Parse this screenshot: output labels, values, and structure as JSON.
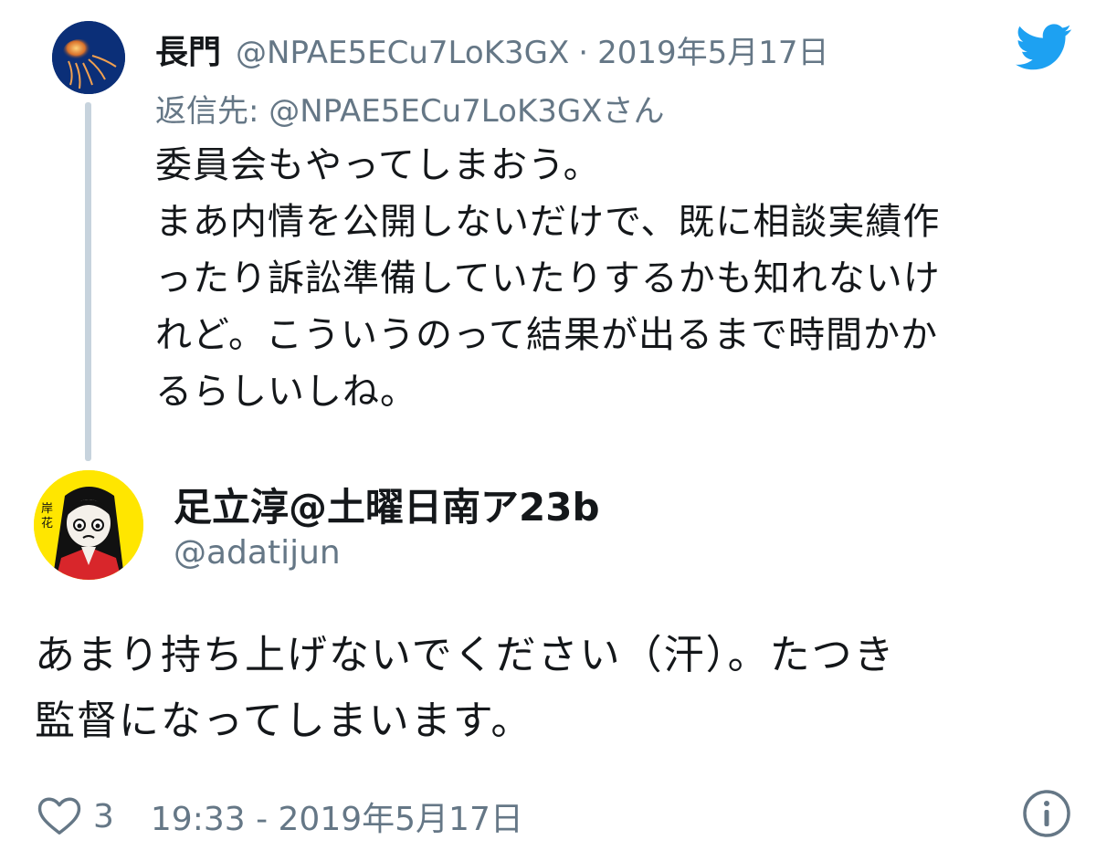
{
  "parent_tweet": {
    "display_name": "長門",
    "handle": "@NPAE5ECu7LoK3GX",
    "separator": "·",
    "date": "2019年5月17日",
    "reply_to": "返信先: @NPAE5ECu7LoK3GXさん",
    "body_lines": [
      "委員会もやってしまおう。",
      "まあ内情を公開しないだけで、既に相談実績作",
      "ったり訴訟準備していたりするかも知れないけ",
      "れど。こういうのって結果が出るまで時間かか",
      "るらしいしね。"
    ]
  },
  "main_tweet": {
    "display_name": "足立淳@土曜日南ア23b",
    "handle": "@adatijun",
    "body_lines": [
      "あまり持ち上げないでください（汗）。たつき",
      "監督になってしまいます。"
    ],
    "like_count": "3",
    "timestamp": "19:33 - 2019年5月17日"
  },
  "icons": {
    "brand": "twitter-bird-icon",
    "like": "heart-icon",
    "info": "info-icon"
  },
  "colors": {
    "text_primary": "#14171a",
    "text_secondary": "#657786",
    "twitter_blue": "#1da1f2",
    "thread_line": "#c7d3dd"
  }
}
